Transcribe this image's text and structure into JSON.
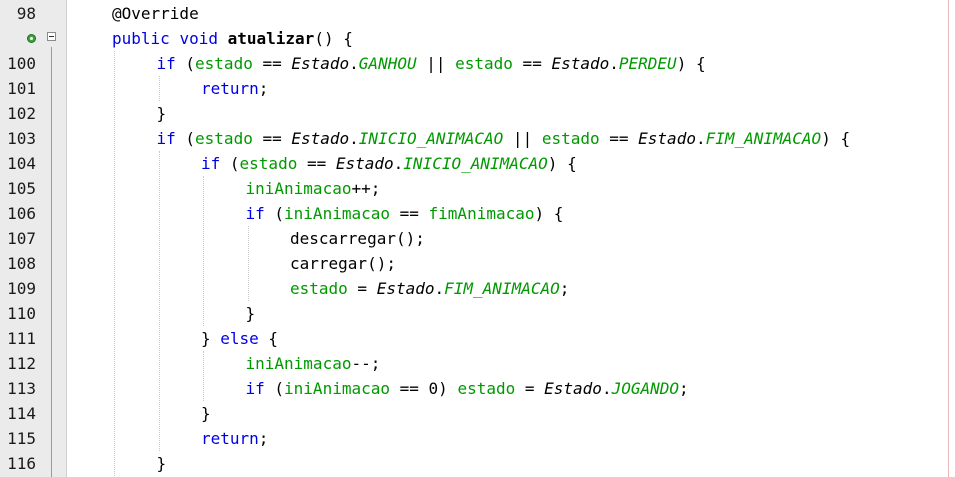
{
  "editor": {
    "lines": [
      {
        "number": "98",
        "marker": "",
        "indent": 1,
        "tokens": [
          {
            "t": "@Override",
            "k": "ann"
          }
        ]
      },
      {
        "number": "",
        "marker": "override-annotation",
        "indent": 1,
        "tokens": [
          {
            "t": "public",
            "k": "kw"
          },
          {
            "t": " ",
            "k": "plain"
          },
          {
            "t": "void",
            "k": "kw"
          },
          {
            "t": " ",
            "k": "plain"
          },
          {
            "t": "atualizar",
            "k": "bold"
          },
          {
            "t": "() {",
            "k": "plain"
          }
        ]
      },
      {
        "number": "100",
        "marker": "",
        "indent": 2,
        "tokens": [
          {
            "t": "if",
            "k": "kw"
          },
          {
            "t": " (",
            "k": "plain"
          },
          {
            "t": "estado",
            "k": "field"
          },
          {
            "t": " == ",
            "k": "plain"
          },
          {
            "t": "Estado",
            "k": "class"
          },
          {
            "t": ".",
            "k": "plain"
          },
          {
            "t": "GANHOU",
            "k": "const"
          },
          {
            "t": " || ",
            "k": "plain"
          },
          {
            "t": "estado",
            "k": "field"
          },
          {
            "t": " == ",
            "k": "plain"
          },
          {
            "t": "Estado",
            "k": "class"
          },
          {
            "t": ".",
            "k": "plain"
          },
          {
            "t": "PERDEU",
            "k": "const"
          },
          {
            "t": ") {",
            "k": "plain"
          }
        ]
      },
      {
        "number": "101",
        "marker": "",
        "indent": 3,
        "tokens": [
          {
            "t": "return",
            "k": "kw"
          },
          {
            "t": ";",
            "k": "plain"
          }
        ]
      },
      {
        "number": "102",
        "marker": "",
        "indent": 2,
        "tokens": [
          {
            "t": "}",
            "k": "plain"
          }
        ]
      },
      {
        "number": "103",
        "marker": "",
        "indent": 2,
        "tokens": [
          {
            "t": "if",
            "k": "kw"
          },
          {
            "t": " (",
            "k": "plain"
          },
          {
            "t": "estado",
            "k": "field"
          },
          {
            "t": " == ",
            "k": "plain"
          },
          {
            "t": "Estado",
            "k": "class"
          },
          {
            "t": ".",
            "k": "plain"
          },
          {
            "t": "INICIO_ANIMACAO",
            "k": "const"
          },
          {
            "t": " || ",
            "k": "plain"
          },
          {
            "t": "estado",
            "k": "field"
          },
          {
            "t": " == ",
            "k": "plain"
          },
          {
            "t": "Estado",
            "k": "class"
          },
          {
            "t": ".",
            "k": "plain"
          },
          {
            "t": "FIM_ANIMACAO",
            "k": "const"
          },
          {
            "t": ") {",
            "k": "plain"
          }
        ]
      },
      {
        "number": "104",
        "marker": "",
        "indent": 3,
        "tokens": [
          {
            "t": "if",
            "k": "kw"
          },
          {
            "t": " (",
            "k": "plain"
          },
          {
            "t": "estado",
            "k": "field"
          },
          {
            "t": " == ",
            "k": "plain"
          },
          {
            "t": "Estado",
            "k": "class"
          },
          {
            "t": ".",
            "k": "plain"
          },
          {
            "t": "INICIO_ANIMACAO",
            "k": "const"
          },
          {
            "t": ") {",
            "k": "plain"
          }
        ]
      },
      {
        "number": "105",
        "marker": "",
        "indent": 4,
        "tokens": [
          {
            "t": "iniAnimacao",
            "k": "field"
          },
          {
            "t": "++;",
            "k": "plain"
          }
        ]
      },
      {
        "number": "106",
        "marker": "",
        "indent": 4,
        "tokens": [
          {
            "t": "if",
            "k": "kw"
          },
          {
            "t": " (",
            "k": "plain"
          },
          {
            "t": "iniAnimacao",
            "k": "field"
          },
          {
            "t": " == ",
            "k": "plain"
          },
          {
            "t": "fimAnimacao",
            "k": "field"
          },
          {
            "t": ") {",
            "k": "plain"
          }
        ]
      },
      {
        "number": "107",
        "marker": "",
        "indent": 5,
        "tokens": [
          {
            "t": "descarregar();",
            "k": "plain"
          }
        ]
      },
      {
        "number": "108",
        "marker": "",
        "indent": 5,
        "tokens": [
          {
            "t": "carregar();",
            "k": "plain"
          }
        ]
      },
      {
        "number": "109",
        "marker": "",
        "indent": 5,
        "tokens": [
          {
            "t": "estado",
            "k": "field"
          },
          {
            "t": " = ",
            "k": "plain"
          },
          {
            "t": "Estado",
            "k": "class"
          },
          {
            "t": ".",
            "k": "plain"
          },
          {
            "t": "FIM_ANIMACAO",
            "k": "const"
          },
          {
            "t": ";",
            "k": "plain"
          }
        ]
      },
      {
        "number": "110",
        "marker": "",
        "indent": 4,
        "tokens": [
          {
            "t": "}",
            "k": "plain"
          }
        ]
      },
      {
        "number": "111",
        "marker": "",
        "indent": 3,
        "tokens": [
          {
            "t": "} ",
            "k": "plain"
          },
          {
            "t": "else",
            "k": "kw"
          },
          {
            "t": " {",
            "k": "plain"
          }
        ]
      },
      {
        "number": "112",
        "marker": "",
        "indent": 4,
        "tokens": [
          {
            "t": "iniAnimacao",
            "k": "field"
          },
          {
            "t": "--;",
            "k": "plain"
          }
        ]
      },
      {
        "number": "113",
        "marker": "",
        "indent": 4,
        "tokens": [
          {
            "t": "if",
            "k": "kw"
          },
          {
            "t": " (",
            "k": "plain"
          },
          {
            "t": "iniAnimacao",
            "k": "field"
          },
          {
            "t": " == 0) ",
            "k": "plain"
          },
          {
            "t": "estado",
            "k": "field"
          },
          {
            "t": " = ",
            "k": "plain"
          },
          {
            "t": "Estado",
            "k": "class"
          },
          {
            "t": ".",
            "k": "plain"
          },
          {
            "t": "JOGANDO",
            "k": "const"
          },
          {
            "t": ";",
            "k": "plain"
          }
        ]
      },
      {
        "number": "114",
        "marker": "",
        "indent": 3,
        "tokens": [
          {
            "t": "}",
            "k": "plain"
          }
        ]
      },
      {
        "number": "115",
        "marker": "",
        "indent": 3,
        "tokens": [
          {
            "t": "return",
            "k": "kw"
          },
          {
            "t": ";",
            "k": "plain"
          }
        ]
      },
      {
        "number": "116",
        "marker": "",
        "indent": 2,
        "tokens": [
          {
            "t": "}",
            "k": "plain"
          }
        ]
      }
    ]
  },
  "colors": {
    "keyword": "#0000e6",
    "field": "#009900",
    "text": "#000000",
    "gutter": "#ebebeb"
  }
}
